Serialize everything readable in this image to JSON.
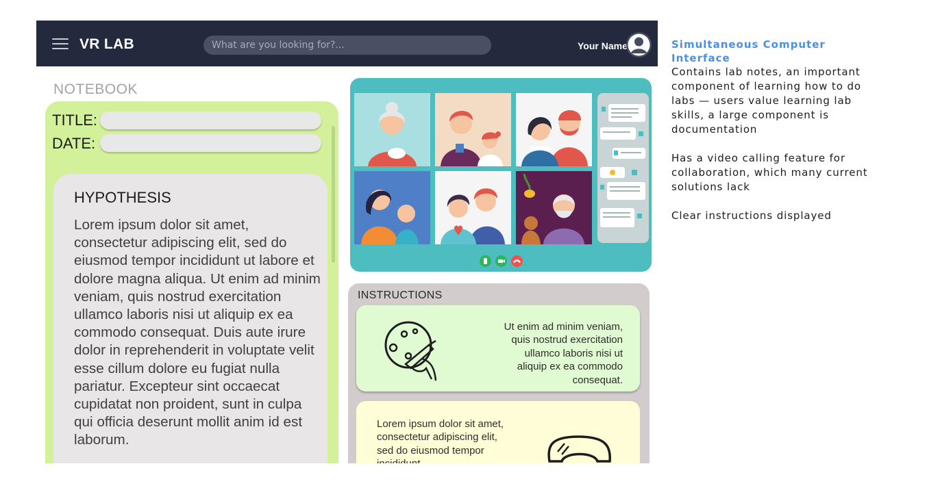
{
  "header": {
    "brand": "VR LAB",
    "search_placeholder": "What are you looking for?...",
    "user_name": "Your Name"
  },
  "notebook": {
    "label": "NOTEBOOK",
    "title_label": "TITLE:",
    "date_label": "DATE:",
    "hypothesis_heading": "HYPOTHESIS",
    "hypothesis_text": "Lorem ipsum dolor sit amet, consectetur adipiscing elit, sed do eiusmod tempor incididunt ut labore et dolore magna aliqua. Ut enim ad minim veniam, quis nostrud exercitation ullamco laboris nisi ut aliquip ex ea commodo consequat. Duis aute irure dolor in reprehenderit in voluptate velit esse cillum dolore eu fugiat nulla pariatur. Excepteur sint occaecat cupidatat non proident, sunt in culpa qui officia deserunt mollit anim id est laborum."
  },
  "video_call": {
    "tile_backgrounds": [
      "#a9dfe0",
      "#f2dcc4",
      "#f5f5f5",
      "#4f7fc6",
      "#f5f5f5",
      "#5a1f4f"
    ],
    "controls": [
      {
        "icon": "microphone-icon",
        "color": "#2fb35d"
      },
      {
        "icon": "camera-icon",
        "color": "#2fb35d"
      },
      {
        "icon": "hang-up-icon",
        "color": "#ef5350"
      }
    ]
  },
  "instructions": {
    "heading": "INSTRUCTIONS",
    "step1_text": "Ut enim ad minim veniam, quis nostrud exercitation ullamco laboris nisi ut aliquip ex ea commodo consequat.",
    "step1_icon": "petri-dish-icon",
    "step2_text": "Lorem ipsum dolor sit amet, consectetur adipiscing elit, sed do eiusmod tempor incididunt",
    "step2_icon": "safety-goggles-icon"
  },
  "annotation": {
    "title": "Simultaneous Computer Interface",
    "p1": "Contains lab notes, an important component of learning how to do labs — users value learning lab skills, a large component is documentation",
    "p2": "Has a video calling feature for collaboration, which many current solutions lack",
    "p3": "Clear instructions displayed"
  },
  "colors": {
    "topbar": "#232a3d",
    "notebook_panel": "#d2f19a",
    "video_panel": "#4dbdbf",
    "instructions_panel": "#d2cccc",
    "accent": "#4a90e2"
  }
}
